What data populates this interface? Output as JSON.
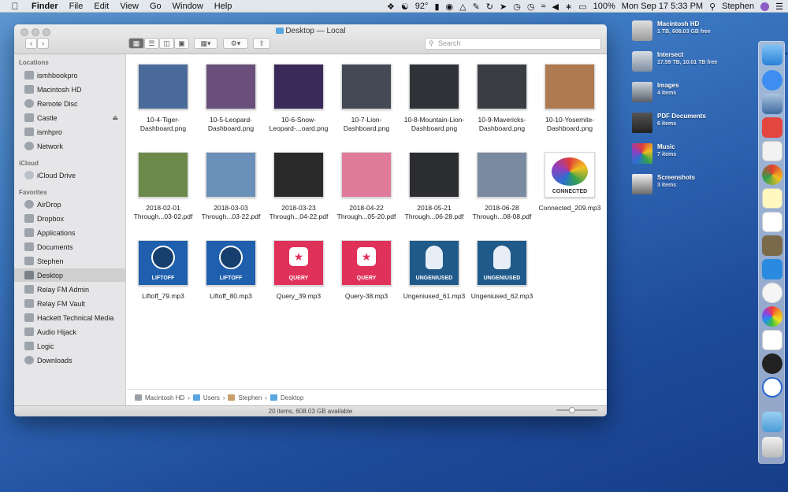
{
  "menubar": {
    "app": "Finder",
    "menus": [
      "File",
      "Edit",
      "View",
      "Go",
      "Window",
      "Help"
    ],
    "temperature": "92°",
    "battery": "100%",
    "datetime": "Mon Sep 17 5:33 PM",
    "user": "Stephen"
  },
  "window": {
    "title": "Desktop — Local",
    "search_placeholder": "Search",
    "status": "20 items, 608.03 GB available"
  },
  "sidebar": {
    "locations_header": "Locations",
    "locations": [
      "ismhbookpro",
      "Macintosh HD",
      "Remote Disc",
      "Castle",
      "ismhpro",
      "Network"
    ],
    "icloud_header": "iCloud",
    "icloud": [
      "iCloud Drive"
    ],
    "favorites_header": "Favorites",
    "favorites": [
      "AirDrop",
      "Dropbox",
      "Applications",
      "Documents",
      "Stephen",
      "Desktop",
      "Relay FM Admin",
      "Relay FM Vault",
      "Hackett Technical Media",
      "Audio Hijack",
      "Logic",
      "Downloads"
    ],
    "selected": "Desktop"
  },
  "files": [
    {
      "name": "10-4-Tiger-Dashboard.png",
      "color": "#4a6a9a"
    },
    {
      "name": "10-5-Leopard-Dashboard.png",
      "color": "#6a4f7a"
    },
    {
      "name": "10-6-Snow-Leopard-...oard.png",
      "color": "#3a2a5a"
    },
    {
      "name": "10-7-Lion-Dashboard.png",
      "color": "#444a55"
    },
    {
      "name": "10-8-Mountain-Lion-Dashboard.png",
      "color": "#2f3338"
    },
    {
      "name": "10-9-Mavericks-Dashboard.png",
      "color": "#3a3d42"
    },
    {
      "name": "10-10-Yosemite-Dashboard.png",
      "color": "#b07a50"
    },
    {
      "name": "2018-02-01 Through...03-02.pdf",
      "color": "#6b8a4a"
    },
    {
      "name": "2018-03-03 Through...03-22.pdf",
      "color": "#6a8fb8"
    },
    {
      "name": "2018-03-23 Through...04-22.pdf",
      "color": "#2a2a2a"
    },
    {
      "name": "2018-04-22 Through...05-20.pdf",
      "color": "#e07a9a"
    },
    {
      "name": "2018-05-21 Through...06-28.pdf",
      "color": "#2b2d31"
    },
    {
      "name": "2018-06-28 Through...08-08.pdf",
      "color": "#7a8aa0"
    },
    {
      "name": "Connected_209.mp3",
      "color": "#ffffff"
    },
    {
      "name": "Liftoff_79.mp3",
      "color": "#1f5fae"
    },
    {
      "name": "Liftoff_80.mp3",
      "color": "#1f5fae"
    },
    {
      "name": "Query_39.mp3",
      "color": "#e0315a"
    },
    {
      "name": "Query-38.mp3",
      "color": "#e0315a"
    },
    {
      "name": "Ungeniused_61.mp3",
      "color": "#1f5a8a"
    },
    {
      "name": "Ungeniused_62.mp3",
      "color": "#1f5a8a"
    }
  ],
  "artwork_labels": {
    "connected": "CONNECTED",
    "liftoff": "LIFTOFF",
    "query": "QUERY",
    "ungeniused": "UNGENIUSED"
  },
  "pathbar": [
    "Macintosh HD",
    "Users",
    "Stephen",
    "Desktop"
  ],
  "desktop_items": [
    {
      "name": "Macintosh HD",
      "detail": "1 TB, 608.03 GB free"
    },
    {
      "name": "Intersect",
      "detail": "17.59 TB, 10.01 TB free"
    },
    {
      "name": "Images",
      "detail": "4 items"
    },
    {
      "name": "PDF Documents",
      "detail": "6 items"
    },
    {
      "name": "Music",
      "detail": "7 items"
    },
    {
      "name": "Screenshots",
      "detail": "3 items"
    }
  ]
}
